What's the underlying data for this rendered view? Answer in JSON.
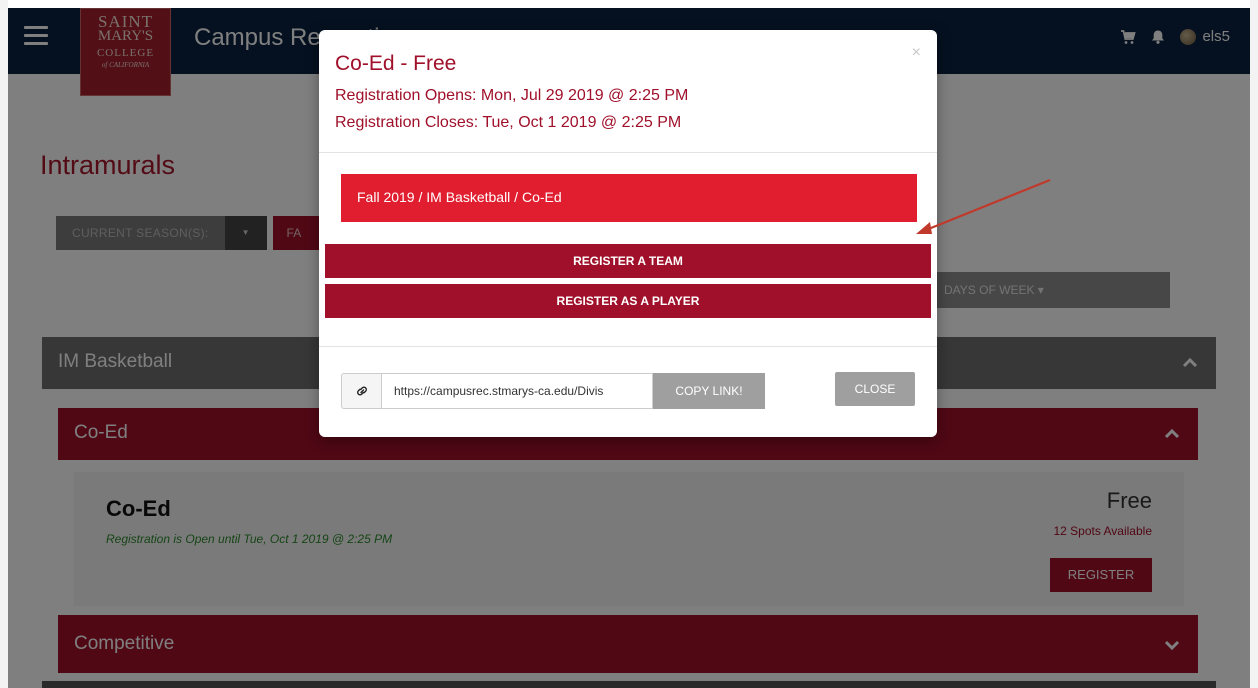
{
  "header": {
    "logo": {
      "line1": "SAINT",
      "line2": "MARY'S",
      "line3": "COLLEGE",
      "line4": "of CALIFORNIA"
    },
    "app_title": "Campus Recreation",
    "username": "els5",
    "icons": [
      "menu-icon",
      "cart-icon",
      "bell-icon",
      "avatar"
    ]
  },
  "page": {
    "title": "Intramurals",
    "season_filter_label": "CURRENT SEASON(S):",
    "season_chip": "FA",
    "days_filter_label": "DAYS OF WEEK ▾",
    "sport_bar": "IM Basketball",
    "division_bar": "Co-Ed",
    "division_card": {
      "title": "Co-Ed",
      "status": "Registration is Open until Tue, Oct 1 2019 @ 2:25 PM",
      "price": "Free",
      "spots": "12 Spots Available",
      "register_label": "REGISTER"
    },
    "competitive_bar": "Competitive"
  },
  "modal": {
    "title": "Co-Ed - Free",
    "opens": "Registration Opens: Mon, Jul 29 2019 @ 2:25 PM",
    "closes": "Registration Closes: Tue, Oct 1 2019 @ 2:25 PM",
    "close_x": "×",
    "breadcrumb": "Fall 2019  /  IM Basketball  /  Co-Ed",
    "register_team_label": "REGISTER A TEAM",
    "register_player_label": "REGISTER AS A PLAYER",
    "link_value": "https://campusrec.stmarys-ca.edu/Divis",
    "copy_link_label": "COPY LINK!",
    "close_label": "CLOSE"
  },
  "colors": {
    "header_bg": "#0b2240",
    "brand_red": "#a0102a",
    "breadcrumb_red": "#e11e2f",
    "status_green": "#2c8a2c"
  }
}
